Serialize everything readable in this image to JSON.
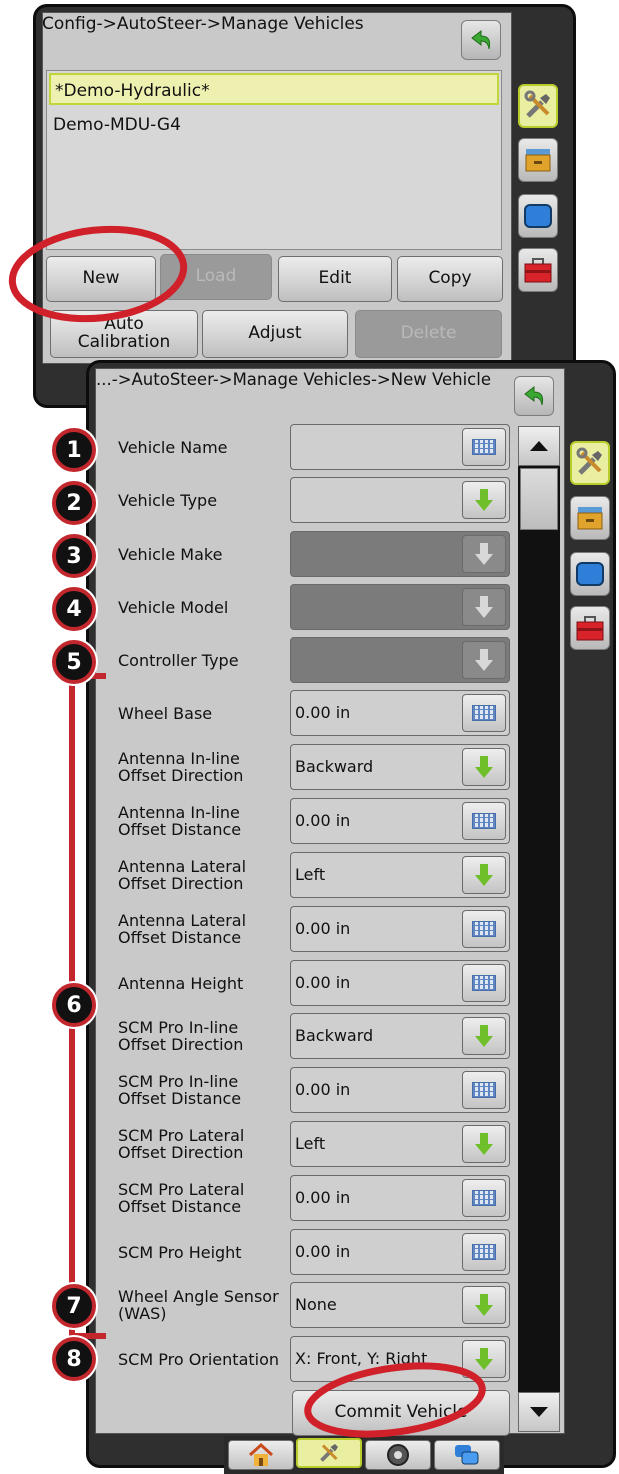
{
  "top_screen": {
    "breadcrumb": "Config->AutoSteer->Manage Vehicles",
    "vehicles": [
      "*Demo-Hydraulic*",
      "Demo-MDU-G4"
    ],
    "buttons": {
      "new": "New",
      "load": "Load",
      "edit": "Edit",
      "copy": "Copy",
      "auto_calibration": "Auto Calibration",
      "adjust": "Adjust",
      "delete": "Delete"
    }
  },
  "bottom_screen": {
    "breadcrumb": "...->AutoSteer->Manage Vehicles->New Vehicle",
    "rows": [
      {
        "label": "Vehicle Name",
        "value": ""
      },
      {
        "label": "Vehicle Type",
        "value": ""
      },
      {
        "label": "Vehicle Make",
        "value": ""
      },
      {
        "label": "Vehicle Model",
        "value": ""
      },
      {
        "label": "Controller Type",
        "value": ""
      },
      {
        "label": "Wheel Base",
        "value": "0.00 in"
      },
      {
        "label": "Antenna In-line Offset Direction",
        "value": "Backward"
      },
      {
        "label": "Antenna In-line Offset Distance",
        "value": "0.00 in"
      },
      {
        "label": "Antenna Lateral Offset Direction",
        "value": "Left"
      },
      {
        "label": "Antenna Lateral Offset Distance",
        "value": "0.00 in"
      },
      {
        "label": "Antenna Height",
        "value": "0.00 in"
      },
      {
        "label": "SCM Pro In-line Offset Direction",
        "value": "Backward"
      },
      {
        "label": "SCM Pro In-line Offset Distance",
        "value": "0.00 in"
      },
      {
        "label": "SCM Pro Lateral Offset Direction",
        "value": "Left"
      },
      {
        "label": "SCM Pro Lateral Offset Distance",
        "value": "0.00 in"
      },
      {
        "label": "SCM Pro Height",
        "value": "0.00 in"
      },
      {
        "label": "Wheel Angle Sensor (WAS)",
        "value": "None"
      },
      {
        "label": "SCM Pro Orientation",
        "value": "X: Front, Y: Right"
      }
    ],
    "commit_button": "Commit Vehicle"
  },
  "callouts": [
    "1",
    "2",
    "3",
    "4",
    "5",
    "6",
    "7",
    "8"
  ],
  "icons": {
    "back": "back-arrow-icon",
    "field_keyboard": "keyboard-icon",
    "field_dropdown": "down-arrow-icon",
    "side_tabs": [
      "tools-icon",
      "data-drawer-icon",
      "display-icon",
      "toolbox-icon"
    ],
    "bottom_nav": [
      "home-icon",
      "tools-icon",
      "gauge-icon",
      "screens-icon"
    ]
  },
  "colors": {
    "callout_ring": "#c1272d",
    "highlight_ellipse": "#d0202a",
    "selection_border": "#c2d63a",
    "dropdown_green": "#6fbf2a"
  }
}
